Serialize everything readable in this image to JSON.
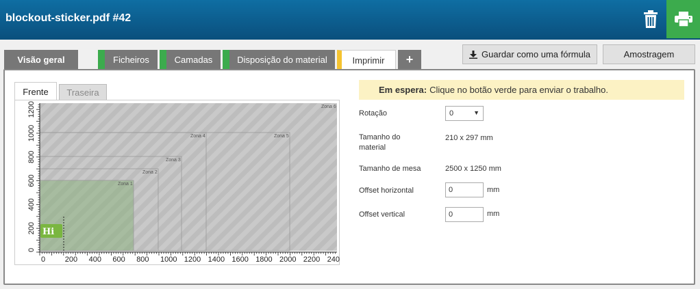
{
  "header": {
    "title": "blockout-sticker.pdf #42",
    "trash_icon": "trash-icon",
    "print_icon": "printer-icon",
    "print_color": "#3cab4d"
  },
  "tabs": [
    {
      "label": "Visão geral",
      "accent": ""
    },
    {
      "label": "Ficheiros",
      "accent": "#3cab4d"
    },
    {
      "label": "Camadas",
      "accent": "#3cab4d"
    },
    {
      "label": "Disposição do material",
      "accent": "#3cab4d"
    },
    {
      "label": "Imprimir",
      "accent": "#f5c330"
    },
    {
      "label": "+",
      "accent": ""
    }
  ],
  "actions": {
    "save_formula": "Guardar como uma fórmula",
    "save_icon": "download-icon",
    "sample": "Amostragem"
  },
  "side_tabs": {
    "front": "Frente",
    "back": "Traseira"
  },
  "preview": {
    "y_ticks": [
      "0",
      "200",
      "400",
      "600",
      "800",
      "1000",
      "1200"
    ],
    "x_ticks": [
      "0",
      "200",
      "400",
      "600",
      "800",
      "1000",
      "1200",
      "1400",
      "1600",
      "1800",
      "2000",
      "2200",
      "240"
    ],
    "zones": [
      "Zona 1",
      "Zona 2",
      "Zona 3",
      "Zona 4",
      "Zona 5",
      "Zona 6"
    ],
    "job_label": "Hi"
  },
  "status": {
    "title": "Em espera:",
    "message": "Clique no botão verde para enviar o trabalho."
  },
  "form": {
    "rotation_label": "Rotação",
    "rotation_value": "0",
    "material_size_label_1": "Tamanho do",
    "material_size_label_2": "material",
    "material_size_value": "210 x 297 mm",
    "table_size_label": "Tamanho de mesa",
    "table_size_value": "2500 x 1250 mm",
    "offset_h_label": "Offset horizontal",
    "offset_h_value": "0",
    "offset_v_label": "Offset vertical",
    "offset_v_value": "0",
    "unit": "mm"
  }
}
